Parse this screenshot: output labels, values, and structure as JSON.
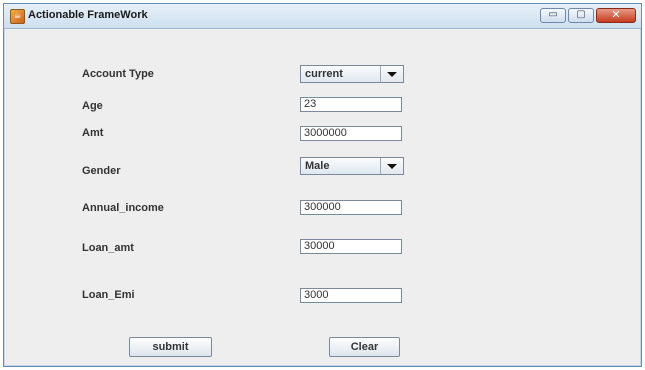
{
  "window": {
    "title": "Actionable FrameWork",
    "minimize_glyph": "▭",
    "maximize_glyph": "▢",
    "close_glyph": "✕"
  },
  "form": {
    "account_type": {
      "label": "Account Type",
      "value": "current"
    },
    "age": {
      "label": "Age",
      "value": "23"
    },
    "amt": {
      "label": "Amt",
      "value": "3000000"
    },
    "gender": {
      "label": "Gender",
      "value": "Male"
    },
    "annual_income": {
      "label": "Annual_income",
      "value": "300000"
    },
    "loan_amt": {
      "label": "Loan_amt",
      "value": "30000"
    },
    "loan_emi": {
      "label": "Loan_Emi",
      "value": "3000"
    }
  },
  "buttons": {
    "submit": "submit",
    "clear": "Clear"
  },
  "colors": {
    "titlebar": "#cddff0",
    "window_bg": "#eeeeee",
    "close_button": "#c43b1e"
  }
}
